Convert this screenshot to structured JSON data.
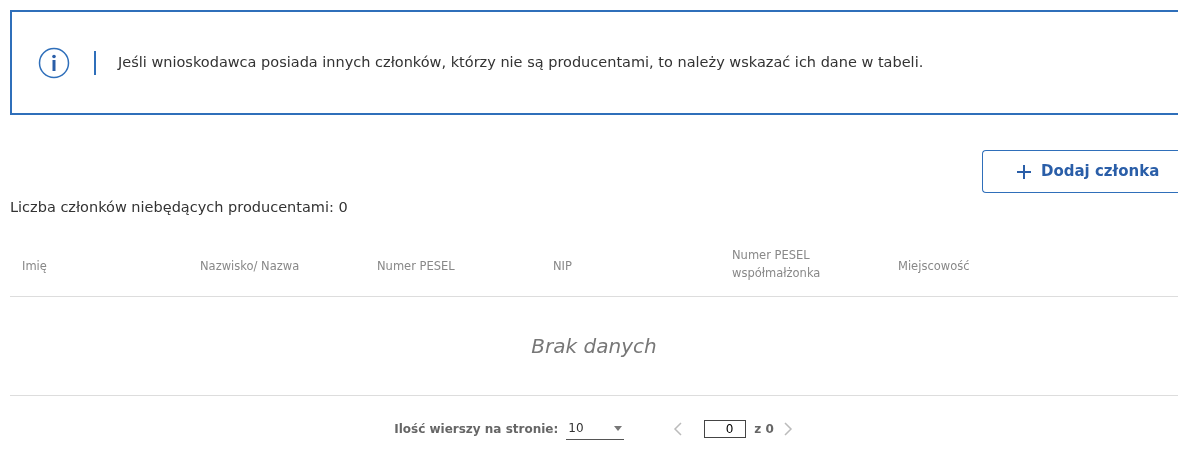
{
  "info": {
    "text": "Jeśli wnioskodawca posiada innych członków, którzy nie są producentami, to należy wskazać ich dane w tabeli."
  },
  "add_button": {
    "label": "Dodaj członka"
  },
  "count_label": "Liczba członków niebędących producentami: 0",
  "table": {
    "columns": [
      "Imię",
      "Nazwisko/ Nazwa",
      "Numer PESEL",
      "NIP",
      "Numer PESEL współmałżonka",
      "Miejscowość"
    ],
    "empty_text": "Brak danych"
  },
  "pagination": {
    "rows_label": "Ilość wierszy na stronie:",
    "rows_value": "10",
    "page_value": "0",
    "of_text": "z 0",
    "prev": {
      "disabled": true
    },
    "next": {
      "disabled": true
    }
  }
}
